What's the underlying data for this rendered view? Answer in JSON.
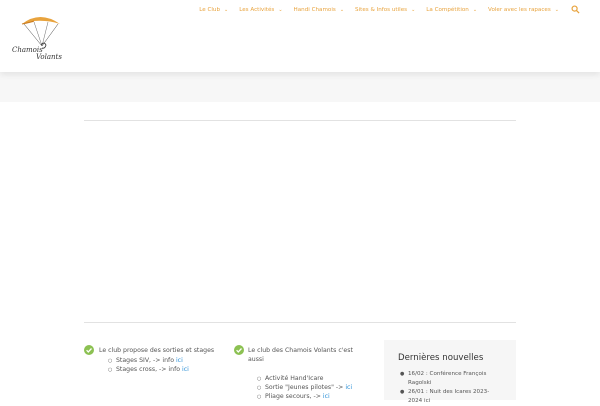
{
  "header": {
    "logo": {
      "text_line1": "Chamois",
      "text_line2": "Volants"
    },
    "nav": [
      {
        "label": "Le Club"
      },
      {
        "label": "Les Activités"
      },
      {
        "label": "Handi Chamois"
      },
      {
        "label": "Sites & Infos utiles"
      },
      {
        "label": "La Compétition"
      },
      {
        "label": "Voler avec les rapaces"
      }
    ],
    "accent_color": "#e8a33d"
  },
  "main": {
    "col1": {
      "intro": "Le club propose des sorties et stages",
      "items": [
        {
          "text": "Stages SIV, -> info ",
          "link": "ici"
        },
        {
          "text": "Stages cross, -> info ",
          "link": "ici"
        }
      ]
    },
    "col2": {
      "intro_line1": "Le club des Chamois Volants c'est",
      "intro_line2": "aussi",
      "items": [
        {
          "text": "Activité Hand'Icare",
          "link": ""
        },
        {
          "text": "Sortie \"Jeunes pilotes\" -> ",
          "link": "ici"
        },
        {
          "text": "Pliage secours, -> ",
          "link": "ici"
        }
      ]
    },
    "news": {
      "title": "Dernières nouvelles",
      "items": [
        {
          "line1": "16/02 : Conférence François",
          "line2": "Ragolski"
        },
        {
          "line1": "26/01 : Nuit des Icares 2023-",
          "line2": "2024 ici"
        }
      ]
    },
    "link_color": "#2a8fd6",
    "check_color": "#8cc152"
  }
}
